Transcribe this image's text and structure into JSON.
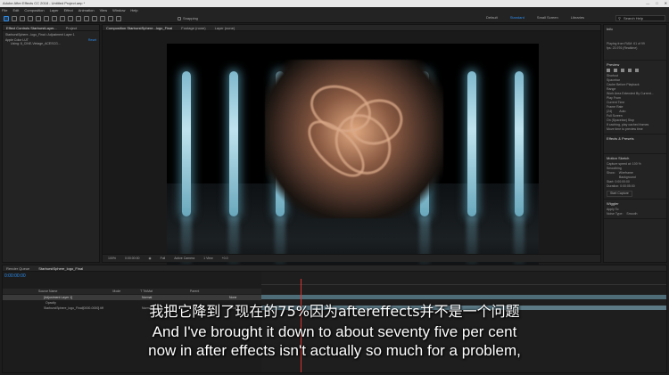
{
  "app": {
    "title": "Adobe After Effects CC 2018 - Untitled Project.aep *",
    "menu": [
      "File",
      "Edit",
      "Composition",
      "Layer",
      "Effect",
      "Animation",
      "View",
      "Window",
      "Help"
    ],
    "snapping_label": "Snapping",
    "workspaces": [
      "Default",
      "Standard",
      "Small Screen",
      "Libraries"
    ],
    "active_workspace": "Standard",
    "search_placeholder": "Search Help"
  },
  "project_panel": {
    "tabs": [
      "Effect Controls StarburstLayer...",
      "Project"
    ],
    "header": "StarburstSphere...logo_Final • Adjustment Layer 1",
    "items": [
      "Apple Color LUT",
      "Using: 8_CINE-Vintage_ACESCG..."
    ],
    "reset_label": "Reset"
  },
  "composition_panel": {
    "tabs": [
      "Composition StarburstSphere...logo_Final",
      "Footage (none)",
      "Layer (none)"
    ],
    "footer": {
      "zoom": "100%",
      "timecode": "0:00:00:00",
      "resolution": "Full",
      "camera": "Active Camera",
      "views": "1 View",
      "offset": "+0.0"
    }
  },
  "right_panel": {
    "info": {
      "title": "Info",
      "line1": "Playing from RAM: 61 of 99",
      "line2": "fps: 23.976 (Realtime)"
    },
    "preview": {
      "title": "Preview",
      "shortcut_label": "Shortcut",
      "shortcut_value": "Spacebar",
      "cache_label": "Cache Before Playback",
      "range_label": "Range",
      "range_value": "Work Area Extended By Current...",
      "playfrom_label": "Play From",
      "playfrom_value": "Current Time",
      "framerate_label": "Frame Rate",
      "framerate_value": "(24)",
      "resolution_value": "Auto",
      "fullscreen_label": "Full Screen",
      "onstop_label": "On (Spacebar) Stop",
      "onstop_opt1": "If caching, play cached frames",
      "onstop_opt2": "Move time to preview time"
    },
    "effects": {
      "title": "Effects & Presets"
    },
    "motion_sketch": {
      "title": "Motion Sketch",
      "capture_label": "Capture speed at: 100 %",
      "smoothing_label": "Smoothing",
      "show_label": "Show:",
      "wireframe_label": "Wireframe",
      "background_label": "Background",
      "start_label": "Start: 0:00:00:00",
      "duration_label": "Duration: 0:00:05:00",
      "start_capture_label": "Start Capture"
    },
    "wiggler": {
      "title": "Wiggler",
      "apply_label": "Apply To:",
      "noise_label": "Noise Type:",
      "noise_value": "Smooth"
    }
  },
  "timeline": {
    "tabs": [
      "Render Queue",
      "StarburstSphere_logo_Final"
    ],
    "timecode": "0:00:00:00",
    "columns": [
      "Source Name",
      "Mode",
      "T TrkMat",
      "Parent"
    ],
    "layers": [
      {
        "name": "[Adjustment Layer 1]",
        "mode": "Normal",
        "parent": "None"
      },
      {
        "name": "Opacity",
        "mode": "",
        "parent": ""
      },
      {
        "name": "StarburstSphere_logo_Final[0000-0000].tiff",
        "mode": "Normal",
        "parent": "None"
      }
    ]
  },
  "subtitles": {
    "chinese": "我把它降到了现在的75%因为aftereffects并不是一个问题",
    "english_line1": "And I've brought it down to about seventy five per cent",
    "english_line2": "now in after effects isn't actually so much for a problem,"
  }
}
